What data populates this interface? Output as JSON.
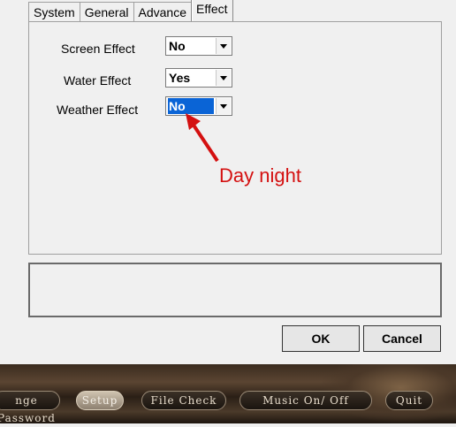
{
  "tabs": [
    "System",
    "General",
    "Advance",
    "Effect"
  ],
  "settings": [
    {
      "label": "Screen Effect",
      "value": "No"
    },
    {
      "label": "Water Effect",
      "value": "Yes"
    },
    {
      "label": "Weather Effect",
      "value": "No"
    }
  ],
  "annotation": {
    "text": "Day night",
    "color": "#d41010"
  },
  "dialog": {
    "ok_label": "OK",
    "cancel_label": "Cancel"
  },
  "game_bar": {
    "buttons": [
      "nge Password",
      "Setup",
      "File Check",
      "Music On/ Off",
      "Quit"
    ],
    "active": "Setup"
  }
}
